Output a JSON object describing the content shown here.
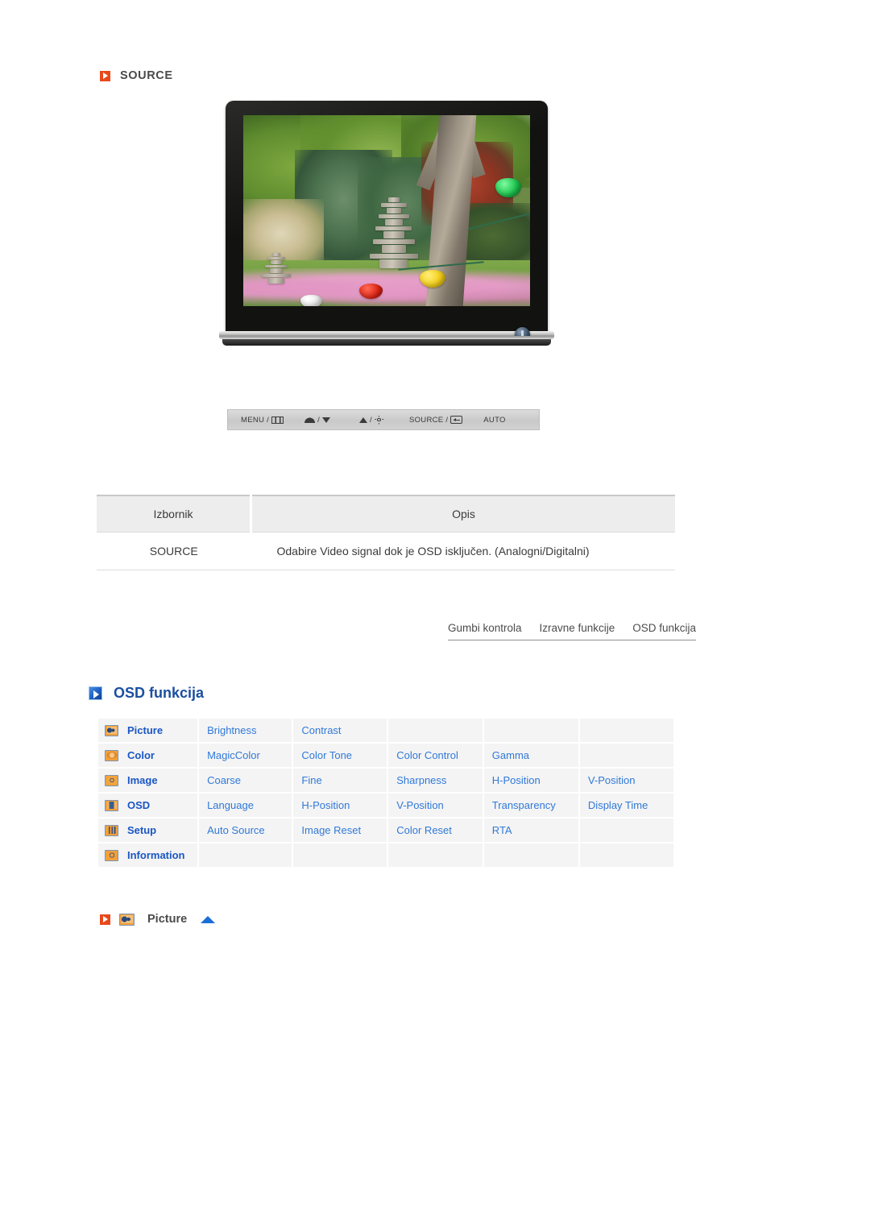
{
  "source_section": {
    "heading": "SOURCE",
    "icon": "orange-play-square-icon"
  },
  "monitor": {
    "alt": "LCD monitor displaying a Korean garden with stone pagodas, trees and paper lanterns",
    "power_button_icon": "power-icon"
  },
  "button_bar": {
    "items": [
      {
        "label": "MENU /",
        "icon": "menu-grid-icon"
      },
      {
        "label": "/",
        "icon_left": "magicbright-icon",
        "icon_right": "triangle-down-icon"
      },
      {
        "label": "/",
        "icon_left": "triangle-up-icon",
        "icon_right": "brightness-sun-icon"
      },
      {
        "label": "SOURCE /",
        "icon": "enter-key-icon"
      },
      {
        "label": "AUTO",
        "icon": null
      }
    ]
  },
  "source_table": {
    "headers": [
      "Izbornik",
      "Opis"
    ],
    "rows": [
      [
        "SOURCE",
        "Odabire Video signal dok je OSD isključen. (Analogni/Digitalni)"
      ]
    ]
  },
  "tabs": [
    {
      "label": "Gumbi kontrola"
    },
    {
      "label": "Izravne funkcije"
    },
    {
      "label": "OSD funkcija"
    }
  ],
  "osd_section": {
    "heading": "OSD funkcija",
    "icon": "blue-play-square-icon"
  },
  "osd_table": {
    "rows": [
      {
        "icon": "picture-icon",
        "category": "Picture",
        "items": [
          "Brightness",
          "Contrast",
          "",
          "",
          ""
        ]
      },
      {
        "icon": "color-icon",
        "category": "Color",
        "items": [
          "MagicColor",
          "Color Tone",
          "Color Control",
          "Gamma",
          ""
        ]
      },
      {
        "icon": "image-icon",
        "category": "Image",
        "items": [
          "Coarse",
          "Fine",
          "Sharpness",
          "H-Position",
          "V-Position"
        ]
      },
      {
        "icon": "osd-icon",
        "category": "OSD",
        "items": [
          "Language",
          "H-Position",
          "V-Position",
          "Transparency",
          "Display Time"
        ]
      },
      {
        "icon": "setup-icon",
        "category": "Setup",
        "items": [
          "Auto Source",
          "Image Reset",
          "Color Reset",
          "RTA",
          ""
        ]
      },
      {
        "icon": "information-icon",
        "category": "Information",
        "items": [
          "",
          "",
          "",
          "",
          ""
        ]
      }
    ]
  },
  "picture_heading": {
    "label": "Picture",
    "marker_icon": "orange-play-square-icon",
    "category_icon": "picture-icon",
    "back_to_top_icon": "up-arrow-icon"
  },
  "colors": {
    "orange_accent": "#e8491c",
    "blue_link": "#3079d8",
    "blue_heading": "#1a4fa0",
    "text_gray": "#4a4a4a",
    "cell_bg": "#f4f4f4",
    "header_bg": "#ededed"
  }
}
